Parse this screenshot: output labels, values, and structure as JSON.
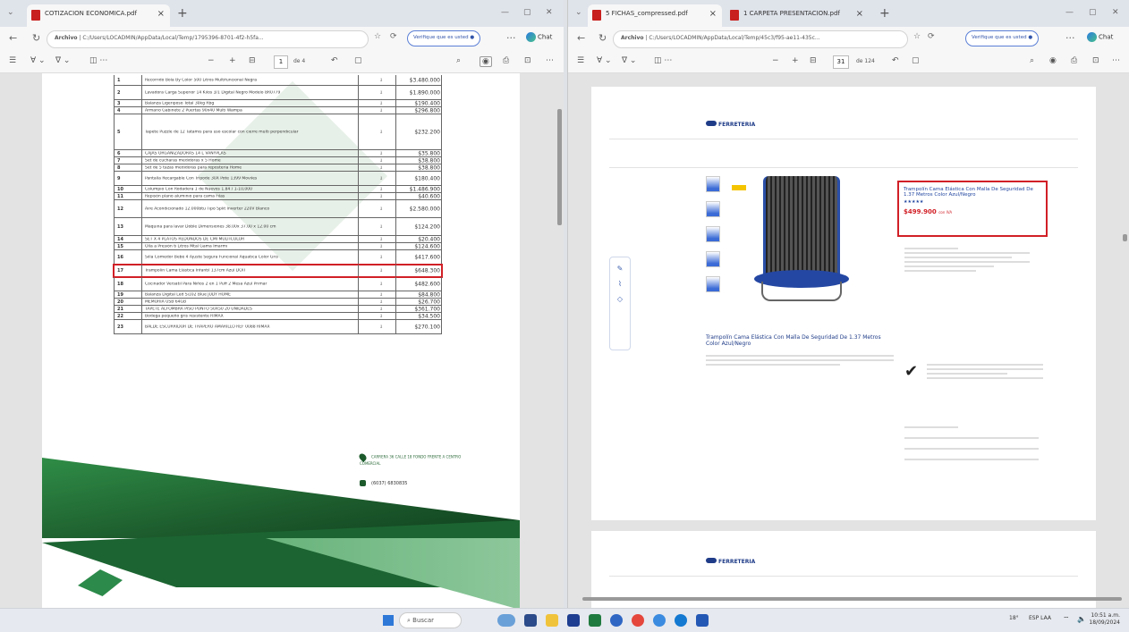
{
  "left_window": {
    "tab_title": "COTIZACION ECONOMICA.pdf",
    "address": "C:/Users/LOCADMIN/AppData/Local/Temp/1795396-8701-4f2-h5fa...",
    "address_prefix": "Archivo",
    "verify_label": "Verifique que es usted",
    "chat_label": "Chat",
    "page_current": "1",
    "page_total": "de 4",
    "table_rows": [
      {
        "n": "1",
        "desc": "Recorrido Bola By Color 500 Litros Multifuncional Negra",
        "qty": "1",
        "price": "$3.480.000"
      },
      {
        "n": "2",
        "desc": "Lavadora Carga Superior 14 Kilos 3/1 Digital Negro Modelo 8R0779",
        "qty": "1",
        "price": "$1.890.000"
      },
      {
        "n": "3",
        "desc": "Balanza Ligeriposo Total 30kg Rbg",
        "qty": "1",
        "price": "$190.400"
      },
      {
        "n": "4",
        "desc": "Armario Gabinete 2 Puertas 90x40 Multi Wampa",
        "qty": "1",
        "price": "$296.800"
      },
      {
        "n": "5",
        "desc": "Tapete Puzzle de 12 Tatamis para uso escolar con cierre multi perpendicular",
        "qty": "1",
        "price": "$232.200"
      },
      {
        "n": "6",
        "desc": "CAJAS ORGANIZADORAS 14 L VANYPLAS",
        "qty": "1",
        "price": "$35.800"
      },
      {
        "n": "7",
        "desc": "Set de cucharas medidoras x 5 Home",
        "qty": "1",
        "price": "$38.800"
      },
      {
        "n": "8",
        "desc": "Set de 5 tazas medidoras para repostería Home",
        "qty": "1",
        "price": "$38.800"
      },
      {
        "n": "9",
        "desc": "Pantalla Recargable Con Trípode 30X Pote 1399 Moviles",
        "qty": "1",
        "price": "$180.400"
      },
      {
        "n": "10",
        "desc": "Columpio Con Rodadera 1 de Nuevos 1.84 / 1-10,000",
        "qty": "1",
        "price": "$1.486.900"
      },
      {
        "n": "11",
        "desc": "Repisón plano aluminio para cama Filas",
        "qty": "1",
        "price": "$40.600"
      },
      {
        "n": "12",
        "desc": "Aire Acondicionado 12.000btu Tipo Split Inverter 220V Blanco",
        "qty": "1",
        "price": "$2.580.000"
      },
      {
        "n": "13",
        "desc": "Máquina para lavar Doble Dimensiones 38.00x 37.00 x 12.00 cm",
        "qty": "1",
        "price": "$124.200"
      },
      {
        "n": "14",
        "desc": "SET X 4 PLATOS REDONDOS DE CMI MULTICOLOR",
        "qty": "1",
        "price": "$20.400"
      },
      {
        "n": "15",
        "desc": "Olla a Presión 6 Litros Mtal Gama Imarmi",
        "qty": "1",
        "price": "$124.600"
      },
      {
        "n": "16",
        "desc": "Silla Comedor Bebé 4 Ajuste Segura Funcional Aquatica Color Gris",
        "qty": "1",
        "price": "$417.600"
      },
      {
        "n": "17",
        "desc": "Trampolín Cama Elástica Infantil 137cm Azul DOIT",
        "qty": "1",
        "price": "$648.300"
      },
      {
        "n": "18",
        "desc": "Cocinador Versátil Para Niños 2 en 1 Puff 2 Mesa Azul Primar",
        "qty": "1",
        "price": "$482.600"
      },
      {
        "n": "19",
        "desc": "Balanza Digital Led Si102 Blue JUDY HOME",
        "qty": "1",
        "price": "$84.800"
      },
      {
        "n": "20",
        "desc": "MEMORIA USB 64GB",
        "qty": "1",
        "price": "$26.700"
      },
      {
        "n": "21",
        "desc": "TAPETE ALFOMBRA PISO PUNTO 50X50 20 UNIDADES",
        "qty": "1",
        "price": "$361.700"
      },
      {
        "n": "22",
        "desc": "Bodega pequeño gris resistente RIMAX",
        "qty": "1",
        "price": "$34.500"
      },
      {
        "n": "23",
        "desc": "BALDE ESCURRIDOR DE TRAPERO AMARILLO REF 0088 RIMAX",
        "qty": "1",
        "price": "$270.100"
      }
    ],
    "contact_address": "CARRERA 36 CALLE 18 FONDO FRENTE A CENTRO COMERCIAL",
    "contact_phone": "(6037) 6830835"
  },
  "right_window": {
    "tab1_title": "5 FICHAS_compressed.pdf",
    "tab2_title": "1 CARPETA PRESENTACION.pdf",
    "address": "C:/Users/LOCADMIN/AppData/Local/Temp/45c3/f95-ae11-435c...",
    "address_prefix": "Archivo",
    "verify_label": "Verifique que es usted",
    "chat_label": "Chat",
    "page_current": "31",
    "page_total": "de 124",
    "store_logo": "FERRETERIA",
    "product_title": "Trampolín Cama Elástica Con Malla De Seguridad De 1.37 Metros Color Azul/Negro",
    "product_stars": "★★★★★",
    "product_price": "$499.900",
    "product_price_suffix": "con IVA",
    "product_desc_title": "Trampolín Cama Elástica Con Malla De Seguridad De 1.37 Metros Color Azul/Negro"
  },
  "taskbar": {
    "search_placeholder": "Buscar",
    "weather": "18°",
    "language": "ESP LAA",
    "time": "10:51 a.m.",
    "date": "18/09/2024"
  },
  "colors": {
    "highlight": "#d11f26",
    "brand_green": "#1c5a2c",
    "pdf_red": "#c8201e"
  }
}
